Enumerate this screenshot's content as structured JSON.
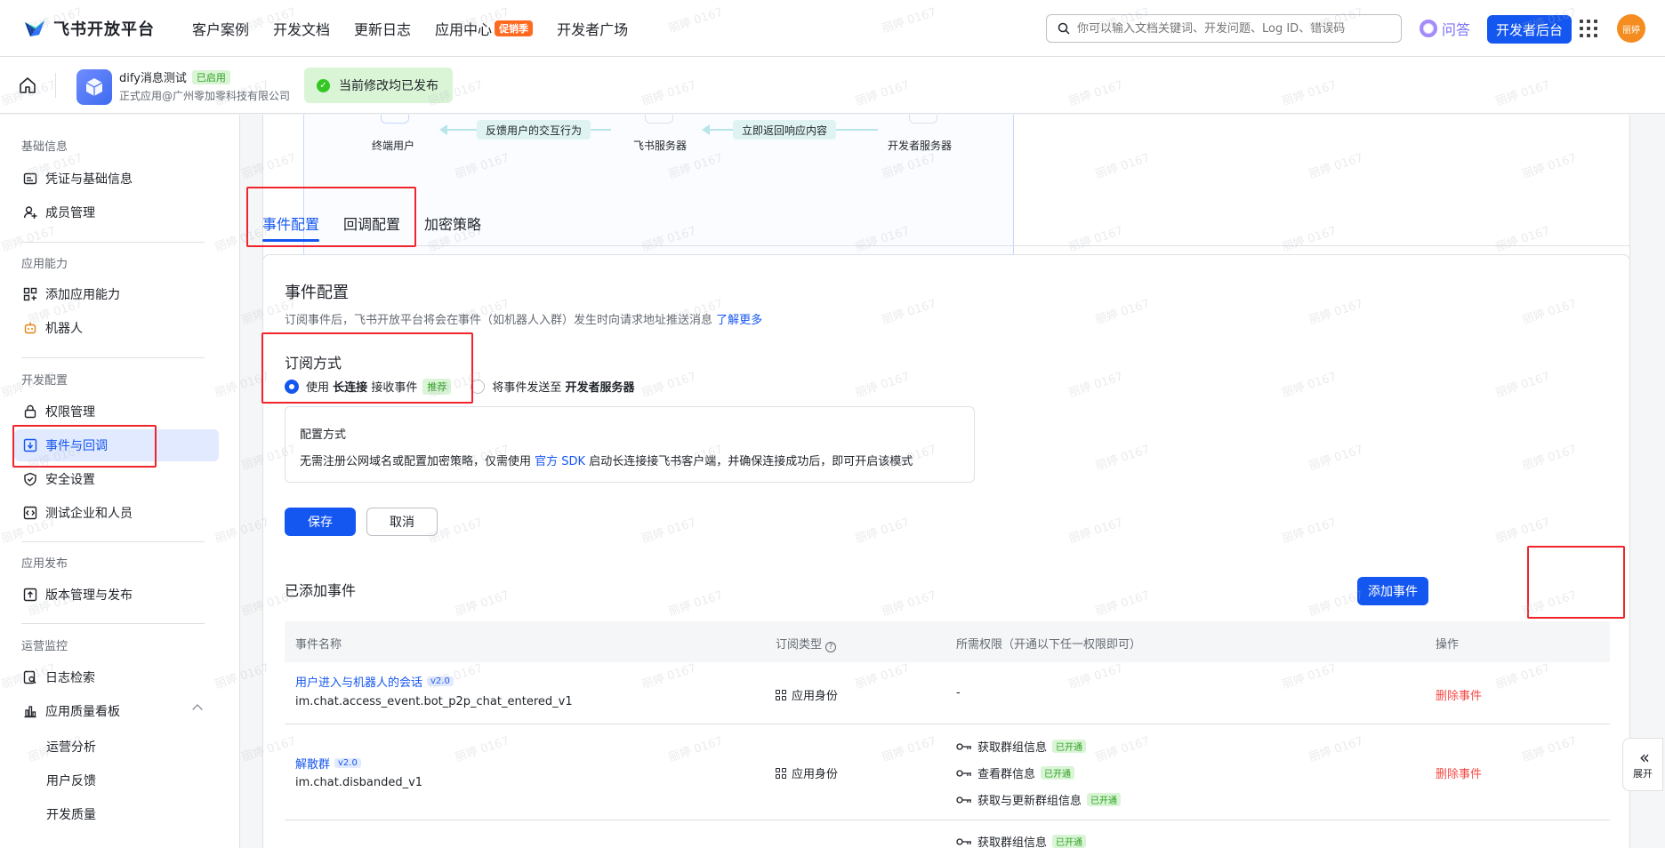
{
  "topnav": {
    "logo_text": "飞书开放平台",
    "links": [
      "客户案例",
      "开发文档",
      "更新日志",
      "应用中心",
      "开发者广场"
    ],
    "promo_badge": "促销季",
    "search_placeholder": "你可以输入文档关键词、开发问题、Log ID、错误码",
    "ask_label": "问答",
    "dev_console_label": "开发者后台",
    "avatar_text": "丽婷",
    "brand_color": "#1456f0"
  },
  "appbar": {
    "app_name": "dify消息测试",
    "status_tag": "已启用",
    "app_sub": "正式应用@广州零加零科技有限公司",
    "published_text": "当前修改均已发布"
  },
  "sidebar": {
    "groups": [
      "基础信息",
      "应用能力",
      "开发配置",
      "应用发布",
      "运营监控"
    ],
    "items": {
      "credentials": "凭证与基础信息",
      "members": "成员管理",
      "add_capability": "添加应用能力",
      "bot": "机器人",
      "permissions": "权限管理",
      "events": "事件与回调",
      "security": "安全设置",
      "test_org": "测试企业和人员",
      "version": "版本管理与发布",
      "logs": "日志检索",
      "quality": "应用质量看板"
    },
    "sub_items": [
      "运营分析",
      "用户反馈",
      "开发质量"
    ]
  },
  "flow": {
    "end_user": "终端用户",
    "feishu_server": "飞书服务器",
    "dev_server": "开发者服务器",
    "arrow1": "反馈用户的交互行为",
    "arrow2": "立即返回响应内容"
  },
  "tabs": [
    "事件配置",
    "回调配置",
    "加密策略"
  ],
  "event_config": {
    "title": "事件配置",
    "desc": "订阅事件后，飞书开放平台将会在事件（如机器人入群）发生时向请求地址推送消息",
    "learn_more": "了解更多",
    "sub_mode_title": "订阅方式",
    "opt1_pre": "使用",
    "opt1_bold": "长连接",
    "opt1_post": "接收事件",
    "recommend": "推荐",
    "opt2_pre": "将事件发送至",
    "opt2_bold": "开发者服务器",
    "cfg_title": "配置方式",
    "cfg_pre": "无需注册公网域名或配置加密策略，仅需使用",
    "cfg_link": "官方 SDK",
    "cfg_post": "启动长连接接飞书客户端，并确保连接成功后，即可开启该模式",
    "save": "保存",
    "cancel": "取消",
    "added_title": "已添加事件",
    "add_event": "添加事件"
  },
  "table": {
    "headers": [
      "事件名称",
      "订阅类型",
      "所需权限（开通以下任一权限即可）",
      "操作"
    ],
    "rows": [
      {
        "name": "用户进入与机器人的会话",
        "version": "v2.0",
        "code": "im.chat.access_event.bot_p2p_chat_entered_v1",
        "sub_type": "应用身份",
        "perms": [
          "-"
        ],
        "action": "删除事件"
      },
      {
        "name": "解散群",
        "version": "v2.0",
        "code": "im.chat.disbanded_v1",
        "sub_type": "应用身份",
        "perms": [
          "获取群组信息",
          "查看群信息",
          "获取与更新群组信息"
        ],
        "perm_tag": "已开通",
        "action": "删除事件"
      },
      {
        "perms": [
          "获取群组信息"
        ],
        "perm_tag": "已开通"
      }
    ]
  },
  "expand_label": "展开",
  "watermark": "丽婷 0167"
}
